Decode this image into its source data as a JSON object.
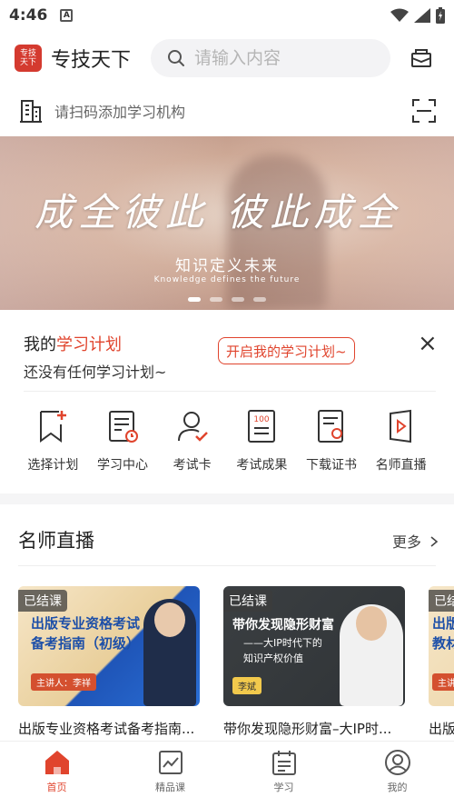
{
  "status": {
    "time": "4:46",
    "sim": "A"
  },
  "header": {
    "app_title": "专技天下",
    "logo_text": "专技天下",
    "search_placeholder": "请输入内容"
  },
  "org_bar": {
    "text": "请扫码添加学习机构"
  },
  "banner": {
    "calligraphy": "成全彼此 彼此成全",
    "subtitle": "知识定义未来",
    "subtitle_en": "Knowledge defines the future",
    "active_slide": 1,
    "slide_count": 4
  },
  "plan": {
    "title_prefix": "我的",
    "title_highlight": "学习计划",
    "subtitle": "还没有任何学习计划~",
    "button": "开启我的学习计划~",
    "close": "×"
  },
  "shortcuts": [
    {
      "label": "选择计划",
      "icon": "bookmark-plus-icon"
    },
    {
      "label": "学习中心",
      "icon": "study-center-icon"
    },
    {
      "label": "考试卡",
      "icon": "exam-card-icon"
    },
    {
      "label": "考试成果",
      "icon": "exam-result-icon"
    },
    {
      "label": "下载证书",
      "icon": "certificate-icon"
    },
    {
      "label": "名师直播",
      "icon": "live-video-icon"
    }
  ],
  "live": {
    "title": "名师直播",
    "more": "更多",
    "cards": [
      {
        "badge": "已结课",
        "thumb_title": "出版专业资格考试\n备考指南（初级）",
        "speaker": "主讲人：李祥",
        "caption": "出版专业资格考试备考指南..."
      },
      {
        "badge": "已结课",
        "thumb_title": "带你发现隐形财富",
        "thumb_sub": "——大IP时代下的\n知识产权价值",
        "speaker": "李斌",
        "caption": "带你发现隐形财富–大IP时..."
      },
      {
        "badge": "已结",
        "thumb_title": "出版\n教材",
        "speaker": "主讲",
        "caption": "出版"
      }
    ]
  },
  "tabbar": {
    "tabs": [
      {
        "label": "首页",
        "active": true
      },
      {
        "label": "精品课",
        "active": false
      },
      {
        "label": "学习",
        "active": false
      },
      {
        "label": "我的",
        "active": false
      }
    ]
  },
  "colors": {
    "accent": "#e0442d",
    "logo": "#d43a2f"
  }
}
